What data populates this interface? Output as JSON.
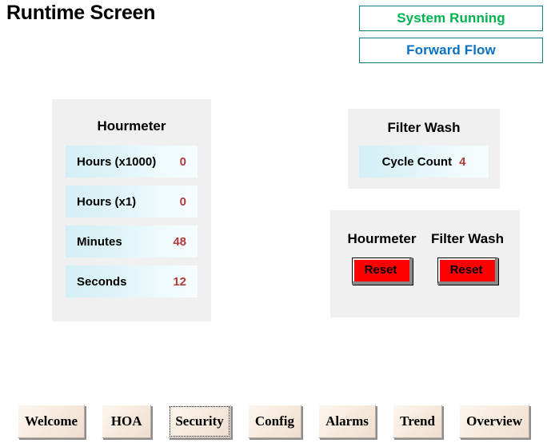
{
  "page": {
    "title": "Runtime Screen"
  },
  "status": {
    "items": [
      {
        "label": "System Running",
        "color": "#00b34f",
        "border": "#117b86"
      },
      {
        "label": "Forward Flow",
        "color": "#0a72c4",
        "border": "#117b86"
      }
    ]
  },
  "hourmeter": {
    "title": "Hourmeter",
    "rows": [
      {
        "label": "Hours (x1000)",
        "value": "0"
      },
      {
        "label": "Hours (x1)",
        "value": "0"
      },
      {
        "label": "Minutes",
        "value": "48"
      },
      {
        "label": "Seconds",
        "value": "12"
      }
    ]
  },
  "filter_wash": {
    "title": "Filter Wash",
    "rows": [
      {
        "label": "Cycle Count",
        "value": "4"
      }
    ]
  },
  "reset_section": {
    "groups": [
      {
        "caption": "Hourmeter",
        "button_label": "Reset"
      },
      {
        "caption": "Filter Wash",
        "button_label": "Reset"
      }
    ]
  },
  "nav": {
    "tabs": [
      {
        "label": "Welcome",
        "selected": false
      },
      {
        "label": "HOA",
        "selected": false
      },
      {
        "label": "Security",
        "selected": true
      },
      {
        "label": "Config",
        "selected": false
      },
      {
        "label": "Alarms",
        "selected": false
      },
      {
        "label": "Trend",
        "selected": false
      },
      {
        "label": "Overview",
        "selected": false
      }
    ]
  },
  "colors": {
    "value_red": "#b23b3b",
    "button_red": "#ff0000",
    "panel_gray": "#f0f0f0",
    "row_cyan": "#d3eff5",
    "status_green": "#00b34f",
    "status_blue": "#0a72c4",
    "status_border": "#117b86"
  }
}
